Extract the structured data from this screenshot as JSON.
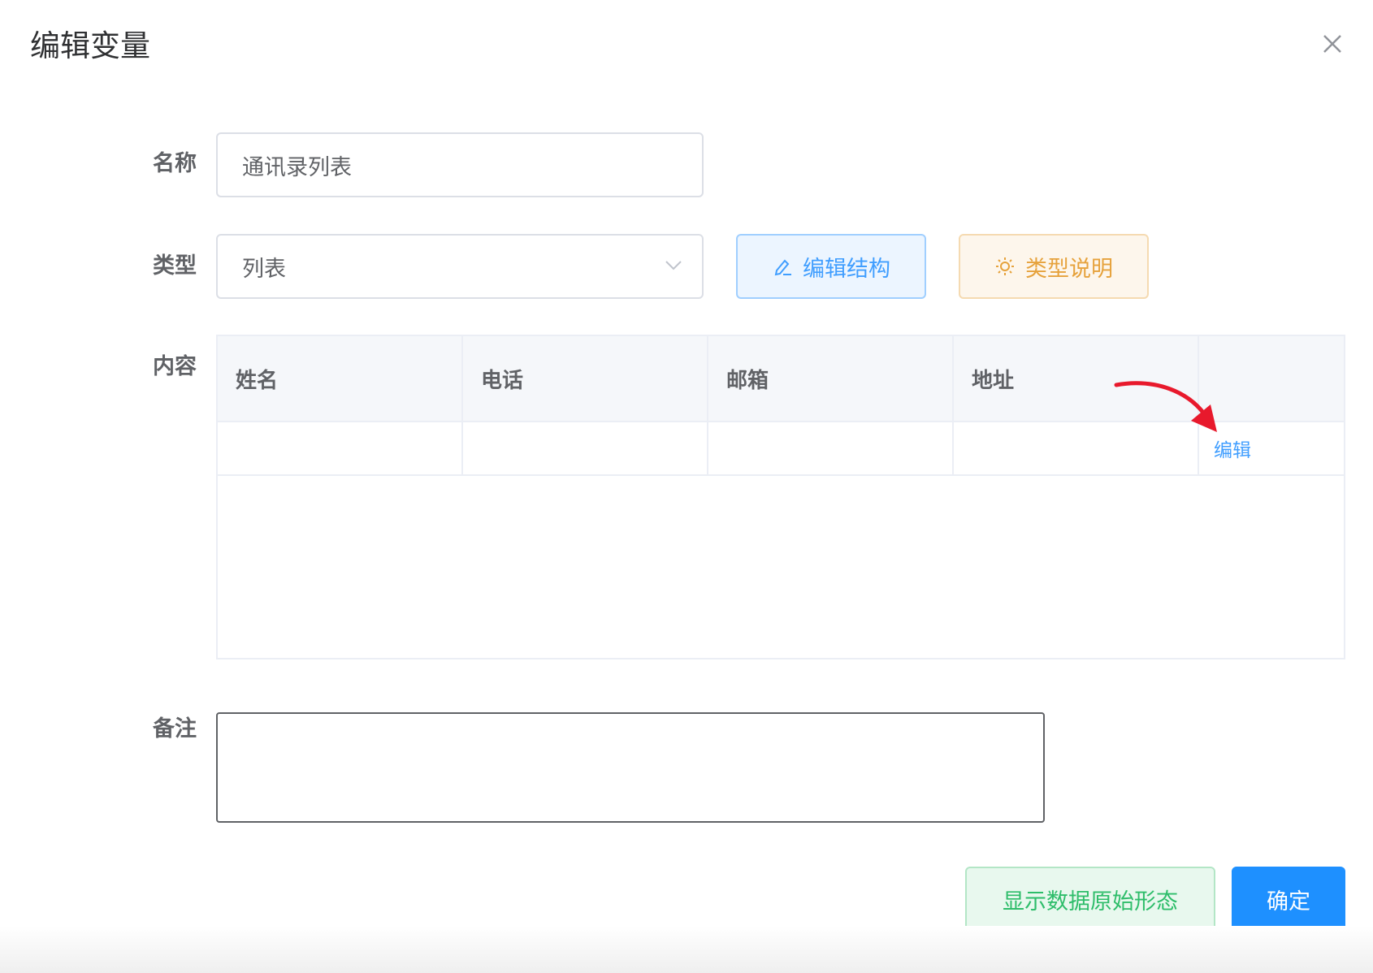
{
  "dialog": {
    "title": "编辑变量"
  },
  "form": {
    "name": {
      "label": "名称",
      "value": "通讯录列表"
    },
    "type": {
      "label": "类型",
      "value": "列表"
    },
    "content": {
      "label": "内容"
    },
    "remark": {
      "label": "备注",
      "value": ""
    }
  },
  "buttons": {
    "edit_structure": "编辑结构",
    "type_help": "类型说明",
    "show_raw": "显示数据原始形态",
    "confirm": "确定"
  },
  "table": {
    "columns": [
      "姓名",
      "电话",
      "邮箱",
      "地址",
      ""
    ],
    "rows": [
      {
        "cells": [
          "",
          "",
          "",
          ""
        ],
        "action": "编辑"
      }
    ]
  },
  "colors": {
    "primary": "#409eff",
    "warning": "#e6a23c",
    "success": "#2ebd6a",
    "confirm": "#1e90ff",
    "annotation_arrow": "#e8192c"
  },
  "icons": [
    "close-icon",
    "chevron-down-icon",
    "pencil-icon",
    "sun-icon",
    "annotation-arrow-icon"
  ]
}
